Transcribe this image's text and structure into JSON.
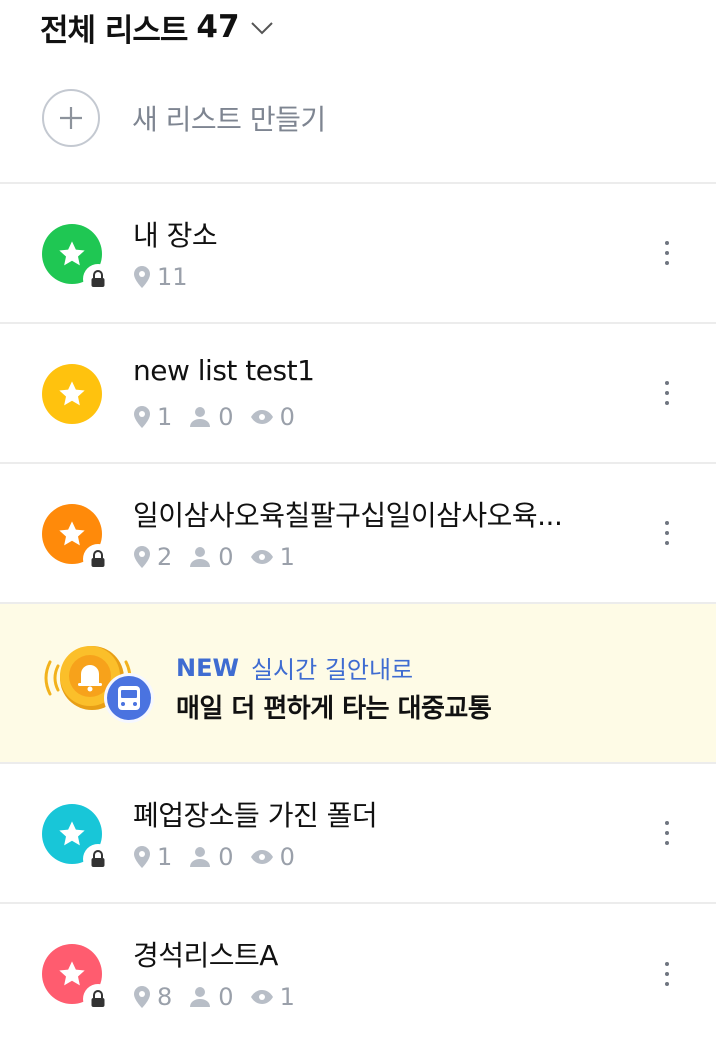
{
  "header": {
    "title": "전체 리스트",
    "count": "47"
  },
  "new_list": {
    "label": "새 리스트 만들기"
  },
  "items_top": [
    {
      "title": "내 장소",
      "color": "#1fc753",
      "locked": true,
      "places": "11",
      "followers": null,
      "views": null
    },
    {
      "title": "new list test1",
      "color": "#ffc20e",
      "locked": false,
      "places": "1",
      "followers": "0",
      "views": "0"
    },
    {
      "title": "일이삼사오육칠팔구십일이삼사오육...",
      "color": "#ff8a0a",
      "locked": true,
      "places": "2",
      "followers": "0",
      "views": "1"
    }
  ],
  "banner": {
    "tag": "NEW",
    "subtitle": "실시간 길안내로",
    "headline": "매일 더 편하게 타는 대중교통",
    "accent": "#3f6cd1",
    "background": "#fefbe6"
  },
  "items_bottom": [
    {
      "title": "폐업장소들 가진 폴더",
      "color": "#18c6d8",
      "locked": true,
      "places": "1",
      "followers": "0",
      "views": "0"
    },
    {
      "title": "경석리스트A",
      "color": "#ff5c6f",
      "locked": true,
      "places": "8",
      "followers": "0",
      "views": "1"
    }
  ]
}
